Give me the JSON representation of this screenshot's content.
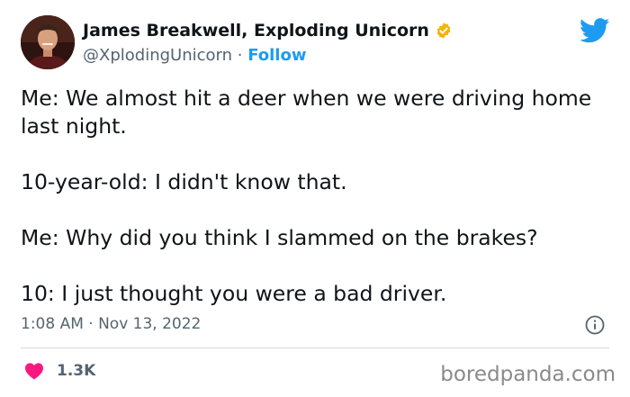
{
  "author": {
    "display_name": "James Breakwell, Exploding Unicorn",
    "handle": "@XplodingUnicorn",
    "separator": " · ",
    "follow_label": "Follow",
    "verified_badge_color": "#f4b400"
  },
  "tweet": {
    "lines": [
      "Me: We almost hit a deer when we were driving home last night.",
      "10-year-old: I didn't know that.",
      "Me: Why did you think I slammed on the brakes?",
      "10: I just thought you were a bad driver."
    ],
    "timestamp": "1:08 AM · Nov 13, 2022"
  },
  "engagement": {
    "likes": "1.3K"
  },
  "watermark": "boredpanda.com",
  "icons": {
    "brand": "twitter-bird-icon",
    "verified": "verified-badge-icon",
    "info": "info-icon",
    "like": "heart-icon"
  },
  "colors": {
    "brand_blue": "#1d9bf0",
    "text_primary": "#0f1419",
    "text_secondary": "#536471",
    "heart": "#f91880",
    "divider": "#cfd9de"
  }
}
